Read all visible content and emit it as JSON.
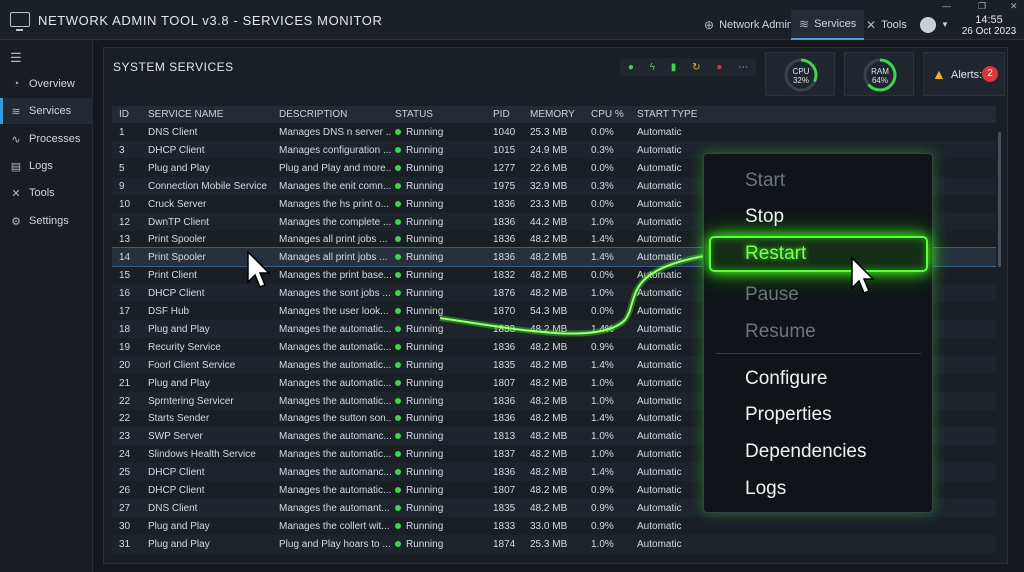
{
  "app": {
    "title": "NETWORK ADMIN TOOL v3.8 - SERVICES MONITOR"
  },
  "topnav": {
    "network_admin": "Network Admin",
    "services": "Services",
    "tools": "Tools"
  },
  "clock": {
    "time": "14:55",
    "date": "26 Oct 2023"
  },
  "sidebar": {
    "items": [
      {
        "label": "Overview"
      },
      {
        "label": "Services"
      },
      {
        "label": "Processes"
      },
      {
        "label": "Logs"
      },
      {
        "label": "Tools"
      },
      {
        "label": "Settings"
      }
    ]
  },
  "panel": {
    "title": "SYSTEM SERVICES"
  },
  "status_strip": {
    "icons": [
      "check-circle-icon",
      "bolt-icon",
      "signal-icon",
      "refresh-icon",
      "stop-icon",
      "more-icon"
    ]
  },
  "metrics": {
    "cpu": {
      "label": "CPU",
      "value": "32%",
      "level": 0.32
    },
    "ram": {
      "label": "RAM",
      "value": "64%",
      "level": 0.64
    }
  },
  "alerts": {
    "label": "Alerts:",
    "count": "2"
  },
  "table": {
    "headers": [
      "ID",
      "SERVICE NAME",
      "DESCRIPTION",
      "STATUS",
      "PID",
      "MEMORY",
      "CPU %",
      "START TYPE"
    ],
    "rows": [
      [
        "1",
        "DNS Client",
        "Manages DNS n server ...",
        "Running",
        "1040",
        "25.3 MB",
        "0.0%",
        "Automatic"
      ],
      [
        "3",
        "DHCP Client",
        "Manages configuration ...",
        "Running",
        "1015",
        "24.9 MB",
        "0.3%",
        "Automatic"
      ],
      [
        "5",
        "Plug and Play",
        "Plug and Play and more...",
        "Running",
        "1277",
        "22.6 MB",
        "0.0%",
        "Automatic"
      ],
      [
        "9",
        "Connection Mobile Service",
        "Manages the enit comn...",
        "Running",
        "1975",
        "32.9 MB",
        "0.3%",
        "Automatic"
      ],
      [
        "10",
        "Cruck Server",
        "Manages the hs print o...",
        "Running",
        "1836",
        "23.3 MB",
        "0.0%",
        "Automatic"
      ],
      [
        "12",
        "DwnTP Client",
        "Manages the complete ...",
        "Running",
        "1836",
        "44.2 MB",
        "1.0%",
        "Automatic"
      ],
      [
        "13",
        "Print Spooler",
        "Manages all print jobs ...",
        "Running",
        "1836",
        "48.2 MB",
        "1.4%",
        "Automatic"
      ],
      [
        "14",
        "Print Spooler",
        "Manages all print jobs ...",
        "Running",
        "1836",
        "48.2 MB",
        "1.4%",
        "Automatic"
      ],
      [
        "15",
        "Print Client",
        "Manages the print base...",
        "Running",
        "1832",
        "48.2 MB",
        "0.0%",
        "Automatic"
      ],
      [
        "16",
        "DHCP Client",
        "Manages the sont jobs ...",
        "Running",
        "1876",
        "48.2 MB",
        "1.0%",
        "Automatic"
      ],
      [
        "17",
        "DSF Hub",
        "Manages the user look...",
        "Running",
        "1870",
        "54.3 MB",
        "0.0%",
        "Automatic"
      ],
      [
        "18",
        "Plug and Play",
        "Manages the automatic...",
        "Running",
        "1833",
        "48.2 MB",
        "1.4%",
        "Automatic"
      ],
      [
        "19",
        "Recurity Service",
        "Manages the automatic...",
        "Running",
        "1836",
        "48.2 MB",
        "0.9%",
        "Automatic"
      ],
      [
        "20",
        "Foorl Client Service",
        "Manages the automatic...",
        "Running",
        "1835",
        "48.2 MB",
        "1.4%",
        "Automatic"
      ],
      [
        "21",
        "Plug and Play",
        "Manages the automatic...",
        "Running",
        "1807",
        "48.2 MB",
        "1.0%",
        "Automatic"
      ],
      [
        "22",
        "Sprntering Servicer",
        "Manages the automatic...",
        "Running",
        "1836",
        "48.2 MB",
        "1.0%",
        "Automatic"
      ],
      [
        "22",
        "Starts Sender",
        "Manages the sutton son...",
        "Running",
        "1836",
        "48.2 MB",
        "1.4%",
        "Automatic"
      ],
      [
        "23",
        "SWP Server",
        "Manages the automanc...",
        "Running",
        "1813",
        "48.2 MB",
        "1.0%",
        "Automatic"
      ],
      [
        "24",
        "Slindows Health Service",
        "Manages the automatic...",
        "Running",
        "1837",
        "48.2 MB",
        "1.0%",
        "Automatic"
      ],
      [
        "25",
        "DHCP Client",
        "Manages the automanc...",
        "Running",
        "1836",
        "48.2 MB",
        "1.4%",
        "Automatic"
      ],
      [
        "26",
        "DHCP Client",
        "Manages the automatic...",
        "Running",
        "1807",
        "48.2 MB",
        "0.9%",
        "Automatic"
      ],
      [
        "27",
        "DNS Client",
        "Manages the automant...",
        "Running",
        "1835",
        "48.2 MB",
        "0.9%",
        "Automatic"
      ],
      [
        "30",
        "Plug and Play",
        "Manages the collert wit...",
        "Running",
        "1833",
        "33.0 MB",
        "0.9%",
        "Automatic"
      ],
      [
        "31",
        "Plug and Play",
        "Plug and Play hoars to ...",
        "Running",
        "1874",
        "25.3 MB",
        "1.0%",
        "Automatic"
      ]
    ],
    "selected_index": 7
  },
  "context_menu": {
    "items": [
      {
        "label": "Start",
        "enabled": false
      },
      {
        "label": "Stop",
        "enabled": true
      },
      {
        "label": "Restart",
        "enabled": true,
        "highlighted": true
      },
      {
        "label": "Pause",
        "enabled": false
      },
      {
        "label": "Resume",
        "enabled": false
      },
      {
        "label": "Configure",
        "enabled": true
      },
      {
        "label": "Properties",
        "enabled": true
      },
      {
        "label": "Dependencies",
        "enabled": true
      },
      {
        "label": "Logs",
        "enabled": true
      }
    ]
  },
  "colors": {
    "accent": "#3a9ad9",
    "running": "#3fd34e",
    "glow": "#39ff14",
    "alert": "#d9363e",
    "warning": "#f0b429"
  }
}
